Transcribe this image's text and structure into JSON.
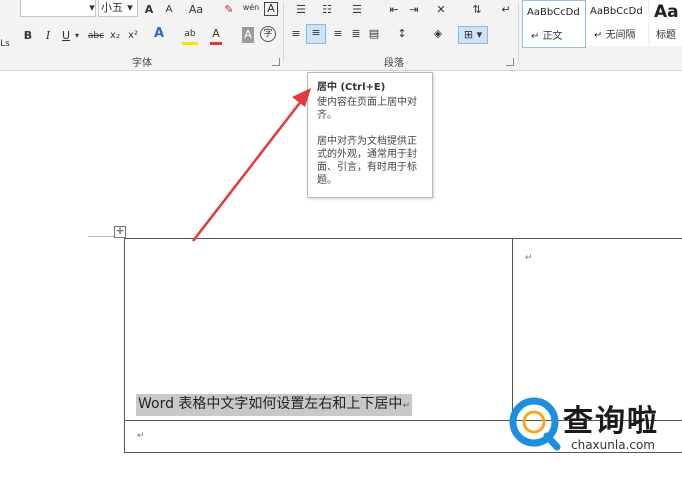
{
  "ribbon": {
    "font_size_value": "小五",
    "font_group_label": "字体",
    "paragraph_group_label": "段落",
    "grow_font": "A",
    "shrink_font": "A",
    "change_case": "Aa",
    "phonetic": "wén",
    "char_border": "A",
    "bold": "B",
    "italic": "I",
    "underline": "U",
    "strikethrough": "abc",
    "subscript": "x₂",
    "superscript": "x²",
    "text_effects": "A",
    "highlight": "ab",
    "font_color": "A",
    "char_shading": "A",
    "enclose": "字",
    "side_mark": "Ls",
    "styles": [
      {
        "preview": "AaBbCcDd",
        "label": "正文"
      },
      {
        "preview": "AaBbCcDd",
        "label": "无间隔"
      },
      {
        "preview": "Aa",
        "label": "标题"
      }
    ]
  },
  "tooltip": {
    "title": "居中 (Ctrl+E)",
    "desc1": "使内容在页面上居中对齐。",
    "desc2": "居中对齐为文档提供正式的外观，通常用于封面、引言，有时用于标题。"
  },
  "document": {
    "cell_text": "Word 表格中文字如何设置左右和上下居中",
    "para_mark": "↵"
  },
  "watermark": {
    "brand": "查询啦",
    "url": "chaxunla.com"
  },
  "colors": {
    "arrow": "#e03a3a",
    "logo_blue": "#1e8fe0",
    "logo_orange": "#f5a623"
  }
}
